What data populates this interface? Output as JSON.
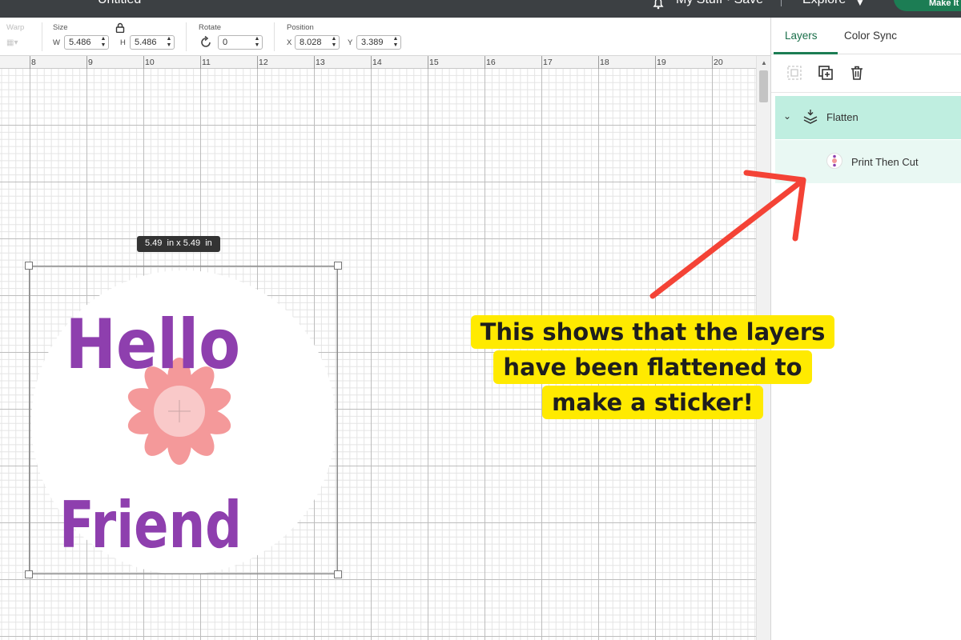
{
  "topbar": {
    "doc_title": "Untitled",
    "my_stuff": "My Stuff",
    "save": "Save",
    "explore": "Explore",
    "make": "Make It"
  },
  "toolbar": {
    "warp_label": "Warp",
    "size_label": "Size",
    "w_label": "W",
    "w_value": "5.486",
    "h_label": "H",
    "h_value": "5.486",
    "rotate_label": "Rotate",
    "rotate_value": "0",
    "position_label": "Position",
    "x_label": "X",
    "x_value": "8.028",
    "y_label": "Y",
    "y_value": "3.389"
  },
  "ruler": {
    "numbers": [
      "8",
      "9",
      "10",
      "11",
      "12",
      "13",
      "14",
      "15",
      "16",
      "17",
      "18",
      "19",
      "20"
    ]
  },
  "canvas": {
    "size_tooltip": "5.49  in x 5.49  in",
    "sticker_top_text": "Hello",
    "sticker_bottom_text": "Friend",
    "text_color": "#8e3fae",
    "flower_color": "#f4999a",
    "flower_center_color": "#f9c9c9"
  },
  "panel": {
    "tabs": [
      {
        "label": "Layers",
        "active": true
      },
      {
        "label": "Color Sync",
        "active": false
      }
    ],
    "tools": [
      "group-icon",
      "duplicate-icon",
      "delete-icon"
    ],
    "group_name": "Flatten",
    "child_name": "Print Then Cut"
  },
  "annotation": {
    "lines": [
      "This shows that the layers",
      "have been flattened to",
      "make a sticker!"
    ],
    "highlight_color": "#ffea00",
    "arrow_color": "#f44336"
  },
  "colors": {
    "accent": "#1c7d54",
    "layer_selected": "#bfeee0",
    "layer_child": "#e9f8f3"
  }
}
